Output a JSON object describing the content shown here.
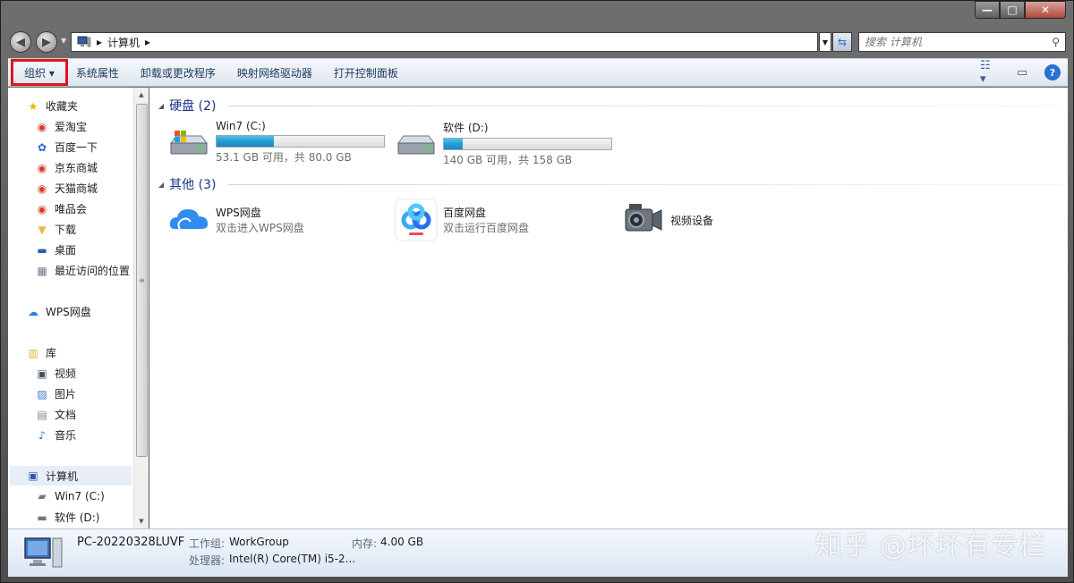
{
  "window": {
    "caption": {
      "minimize": "—",
      "maximize": "□",
      "close": "✕"
    }
  },
  "address": {
    "back": "◀",
    "forward": "▶",
    "path": "计算机",
    "separator": "▸",
    "search_placeholder": "搜索 计算机"
  },
  "toolbar": {
    "organize": "组织 ▾",
    "system_properties": "系统属性",
    "uninstall": "卸载或更改程序",
    "map_drive": "映射网络驱动器",
    "control_panel": "打开控制面板"
  },
  "nav": {
    "favorites": "收藏夹",
    "fav_items": [
      "爱淘宝",
      "百度一下",
      "京东商城",
      "天猫商城",
      "唯品会",
      "下载",
      "桌面",
      "最近访问的位置"
    ],
    "wps": "WPS网盘",
    "library": "库",
    "lib_items": [
      "视频",
      "图片",
      "文档",
      "音乐"
    ],
    "computer": "计算机",
    "drives": [
      "Win7 (C:)",
      "软件 (D:)"
    ]
  },
  "content": {
    "hdd_header": "硬盘 (2)",
    "drives": [
      {
        "name": "Win7 (C:)",
        "free_text": "53.1 GB 可用，共 80.0 GB",
        "used_fraction": 0.34
      },
      {
        "name": "软件 (D:)",
        "free_text": "140 GB 可用，共 158 GB",
        "used_fraction": 0.11
      }
    ],
    "other_header": "其他 (3)",
    "others": [
      {
        "name": "WPS网盘",
        "sub": "双击进入WPS网盘"
      },
      {
        "name": "百度网盘",
        "sub": "双击运行百度网盘"
      },
      {
        "name": "视频设备",
        "sub": ""
      }
    ]
  },
  "details": {
    "pc_name": "PC-20220328LUVF",
    "workgroup_label": "工作组:",
    "workgroup": "WorkGroup",
    "memory_label": "内存:",
    "memory": "4.00 GB",
    "cpu_label": "处理器:",
    "cpu": "Intel(R) Core(TM) i5-2..."
  },
  "watermark": "知乎 @坏坏有专栏",
  "colors": {
    "accent": "#1e3287",
    "bar_fill": "#26a0da",
    "highlight_box": "#e0141a"
  }
}
